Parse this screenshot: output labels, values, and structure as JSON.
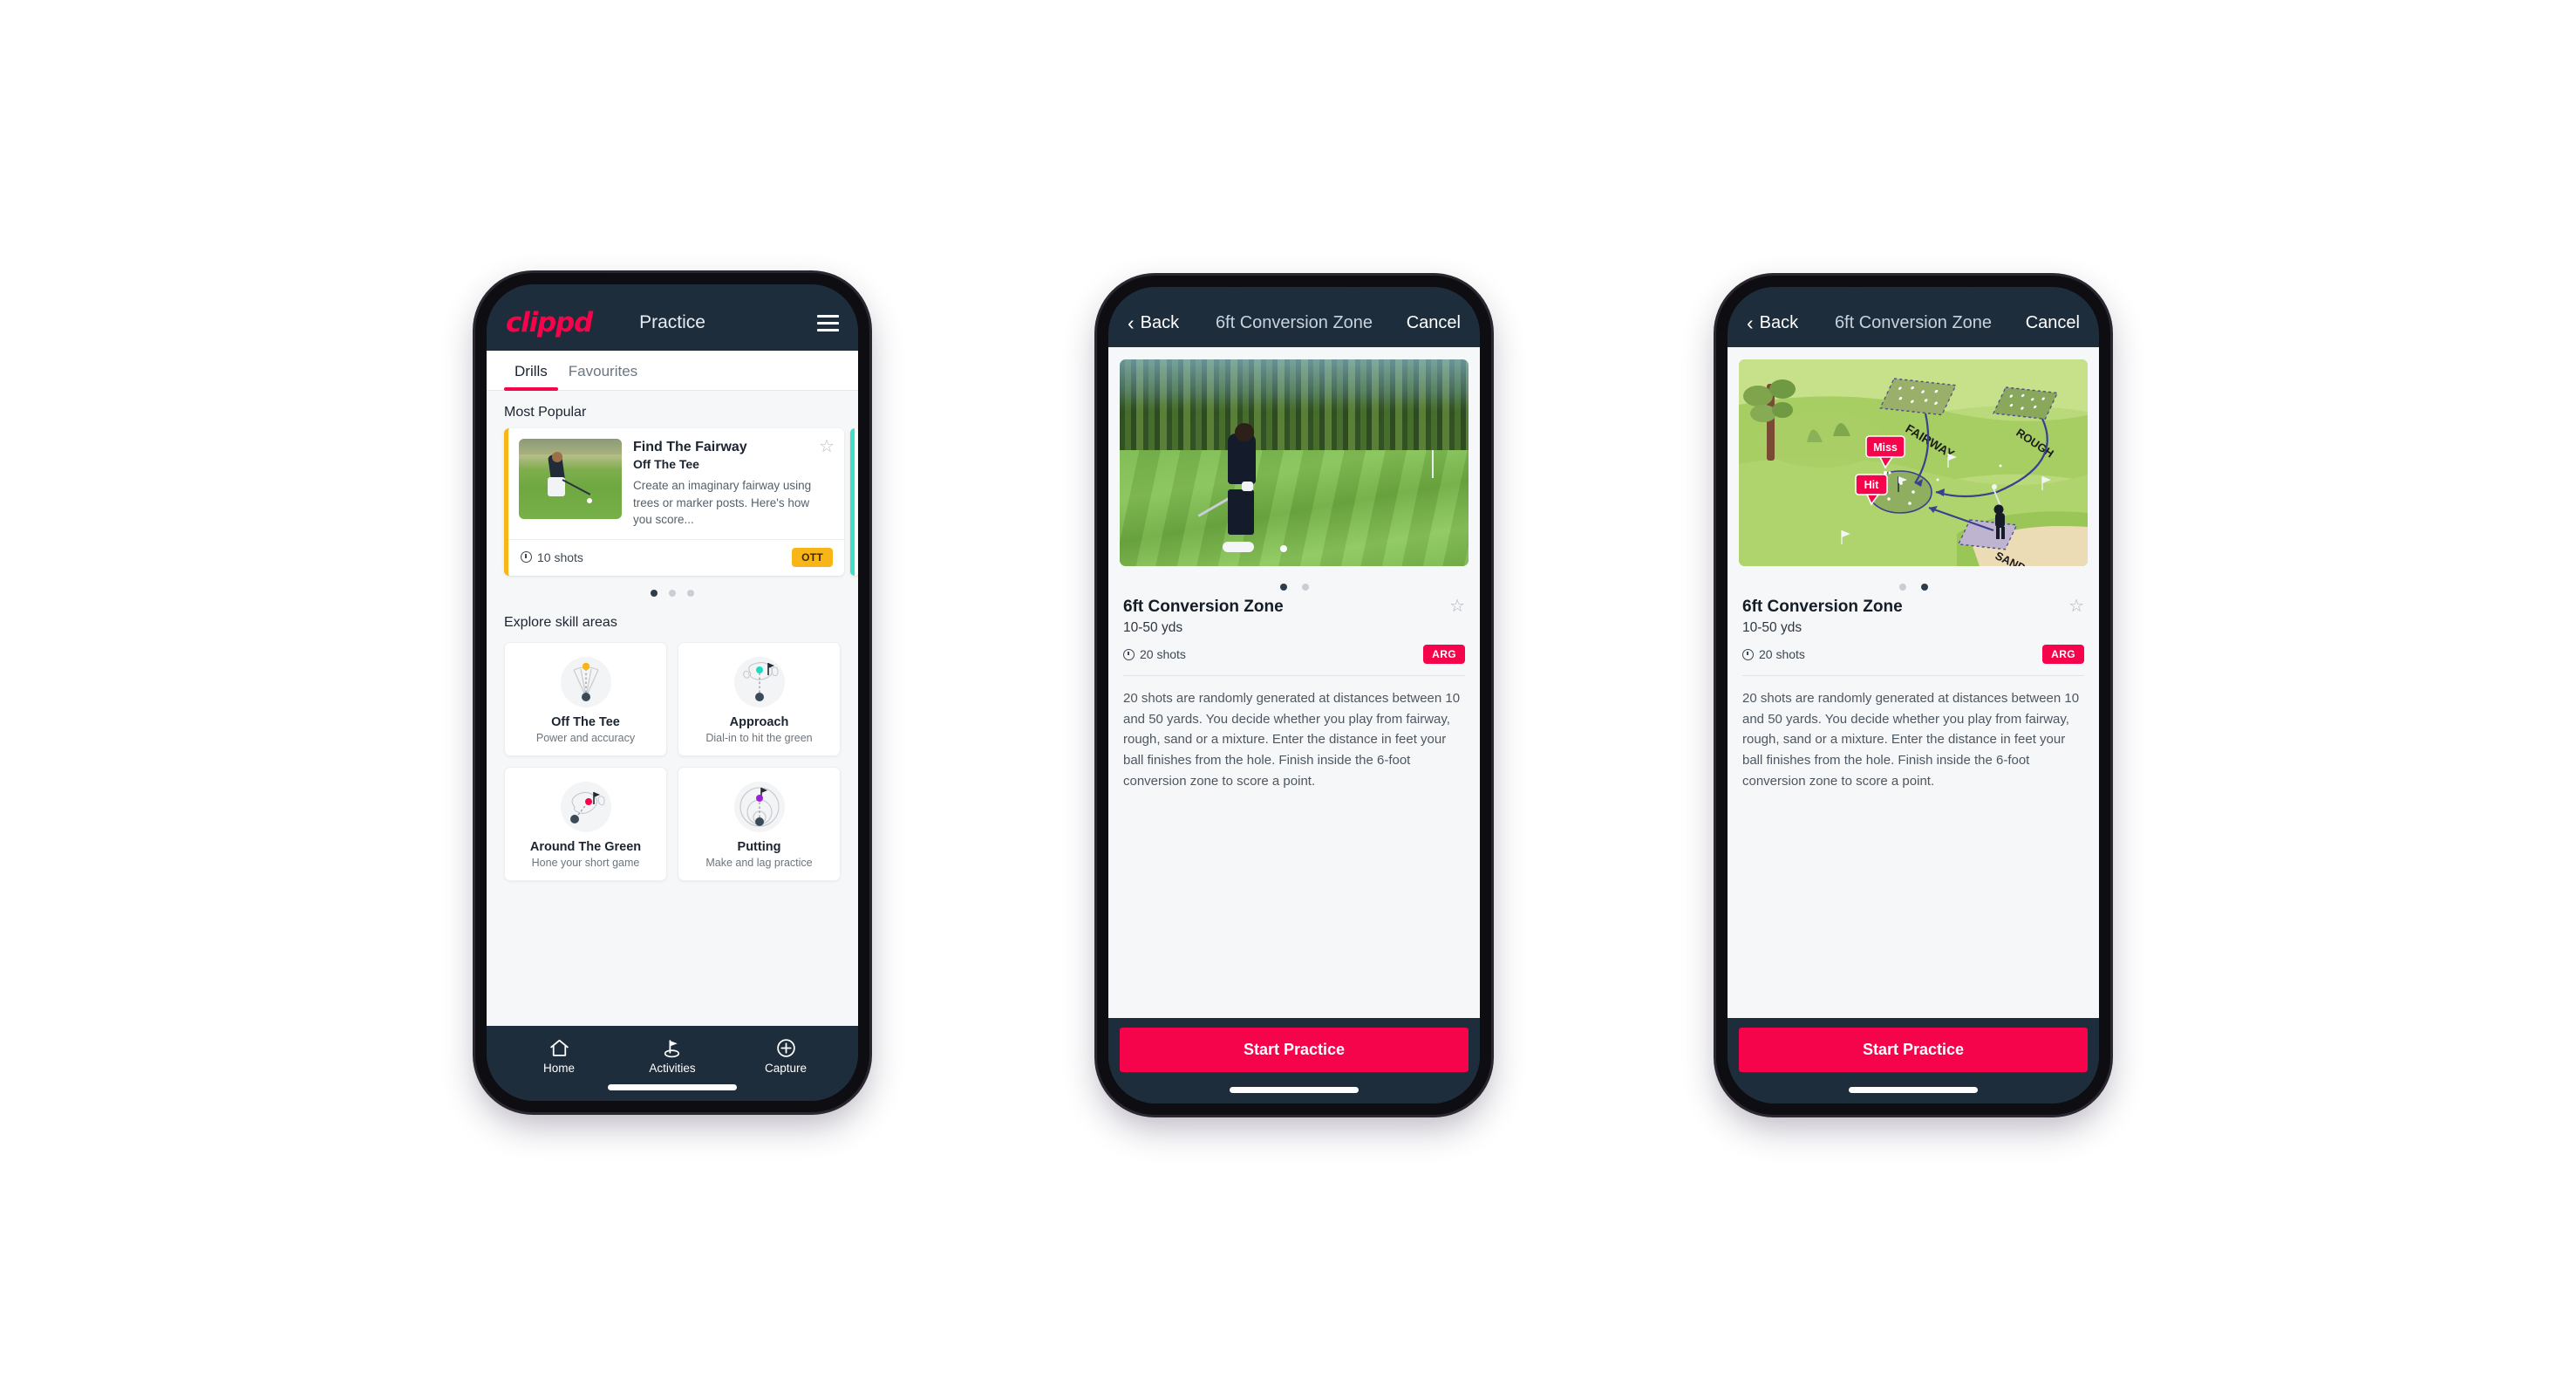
{
  "phone1": {
    "navbar": {
      "brand": "clippd",
      "title": "Practice",
      "menu_icon": "hamburger-menu-icon"
    },
    "tabs": [
      {
        "label": "Drills",
        "active": true
      },
      {
        "label": "Favourites",
        "active": false
      }
    ],
    "sections": {
      "most_popular_title": "Most Popular",
      "explore_title": "Explore skill areas"
    },
    "popular_card": {
      "title": "Find The Fairway",
      "subtitle": "Off The Tee",
      "description": "Create an imaginary fairway using trees or marker posts. Here's how you score...",
      "shots": "10 shots",
      "badge": "OTT",
      "badge_color": "#f7b518",
      "star_icon": "star-outline-icon",
      "accent_color": "#f7b518",
      "next_card_accent": "#3fe0c8"
    },
    "carousel_dots": {
      "count": 3,
      "active_index": 0
    },
    "skills": [
      {
        "name": "Off The Tee",
        "desc": "Power and accuracy",
        "marker_color": "#f7b518"
      },
      {
        "name": "Approach",
        "desc": "Dial-in to hit the green",
        "marker_color": "#19dcc0"
      },
      {
        "name": "Around The Green",
        "desc": "Hone your short game",
        "marker_color": "#f5044c"
      },
      {
        "name": "Putting",
        "desc": "Make and lag practice",
        "marker_color": "#9b1fd4"
      }
    ],
    "tabbar": [
      {
        "label": "Home",
        "icon": "home-icon",
        "active": false
      },
      {
        "label": "Activities",
        "icon": "golf-flag-icon",
        "active": true
      },
      {
        "label": "Capture",
        "icon": "plus-circle-icon",
        "active": false
      }
    ]
  },
  "phone2": {
    "navbar": {
      "back": "Back",
      "title": "6ft Conversion Zone",
      "cancel": "Cancel",
      "back_icon": "chevron-left-icon"
    },
    "hero_type": "photo",
    "carousel_dots": {
      "count": 2,
      "active_index": 0
    },
    "detail": {
      "title": "6ft Conversion Zone",
      "yardage": "10-50 yds",
      "shots": "20 shots",
      "badge": "ARG",
      "badge_color": "#f5044c",
      "star_icon": "star-outline-icon",
      "description": "20 shots are randomly generated at distances between 10 and 50 yards. You decide whether you play from fairway, rough, sand or a mixture. Enter the distance in feet your ball finishes from the hole. Finish inside the 6-foot conversion zone to score a point."
    },
    "cta": "Start Practice"
  },
  "phone3": {
    "navbar": {
      "back": "Back",
      "title": "6ft Conversion Zone",
      "cancel": "Cancel",
      "back_icon": "chevron-left-icon"
    },
    "hero_type": "illustration",
    "illustration_labels": {
      "fairway": "FAIRWAY",
      "rough": "ROUGH",
      "sand": "SAND",
      "miss": "Miss",
      "hit": "Hit"
    },
    "carousel_dots": {
      "count": 2,
      "active_index": 1
    },
    "detail": {
      "title": "6ft Conversion Zone",
      "yardage": "10-50 yds",
      "shots": "20 shots",
      "badge": "ARG",
      "badge_color": "#f5044c",
      "star_icon": "star-outline-icon",
      "description": "20 shots are randomly generated at distances between 10 and 50 yards. You decide whether you play from fairway, rough, sand or a mixture. Enter the distance in feet your ball finishes from the hole. Finish inside the 6-foot conversion zone to score a point."
    },
    "cta": "Start Practice"
  }
}
